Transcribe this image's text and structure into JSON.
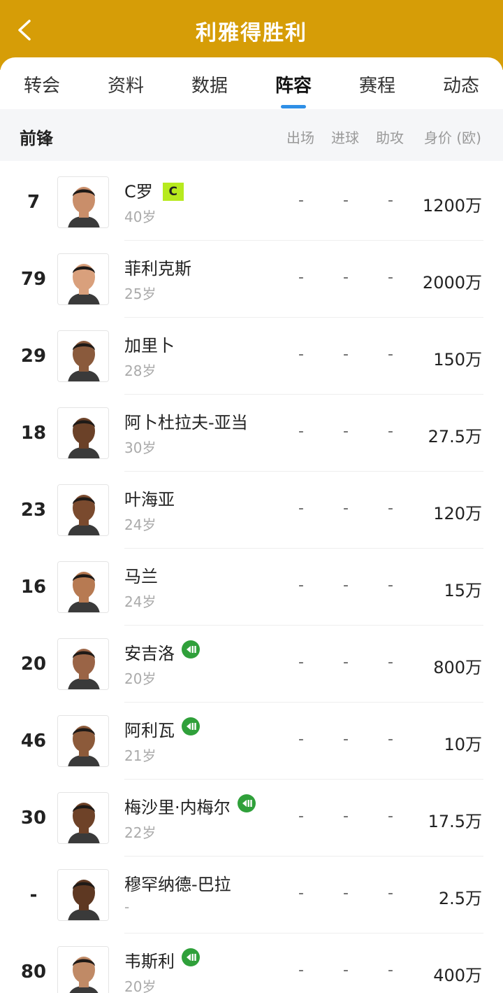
{
  "header": {
    "title": "利雅得胜利"
  },
  "tabs": [
    "转会",
    "资料",
    "数据",
    "阵容",
    "赛程",
    "动态"
  ],
  "active_tab": "阵容",
  "section": {
    "title": "前锋",
    "columns": [
      "出场",
      "进球",
      "助攻",
      "身价 (欧)"
    ]
  },
  "colors": {
    "header": "#D69D07",
    "tab_indicator": "#2F8FE6",
    "captain_badge": "#B7EA1E",
    "u_badge": "#2FA03A"
  },
  "players": [
    {
      "number": "7",
      "name": "C罗",
      "age": "40岁",
      "apps": "-",
      "goals": "-",
      "assists": "-",
      "value": "1200万",
      "captain": "C",
      "u_badge": false
    },
    {
      "number": "79",
      "name": "菲利克斯",
      "age": "25岁",
      "apps": "-",
      "goals": "-",
      "assists": "-",
      "value": "2000万",
      "u_badge": false
    },
    {
      "number": "29",
      "name": "加里卜",
      "age": "28岁",
      "apps": "-",
      "goals": "-",
      "assists": "-",
      "value": "150万",
      "u_badge": false
    },
    {
      "number": "18",
      "name": "阿卜杜拉夫-亚当",
      "age": "30岁",
      "apps": "-",
      "goals": "-",
      "assists": "-",
      "value": "27.5万",
      "u_badge": false
    },
    {
      "number": "23",
      "name": "叶海亚",
      "age": "24岁",
      "apps": "-",
      "goals": "-",
      "assists": "-",
      "value": "120万",
      "u_badge": false
    },
    {
      "number": "16",
      "name": "马兰",
      "age": "24岁",
      "apps": "-",
      "goals": "-",
      "assists": "-",
      "value": "15万",
      "u_badge": false
    },
    {
      "number": "20",
      "name": "安吉洛",
      "age": "20岁",
      "apps": "-",
      "goals": "-",
      "assists": "-",
      "value": "800万",
      "u_badge": true
    },
    {
      "number": "46",
      "name": "阿利瓦",
      "age": "21岁",
      "apps": "-",
      "goals": "-",
      "assists": "-",
      "value": "10万",
      "u_badge": true
    },
    {
      "number": "30",
      "name": "梅沙里·内梅尔",
      "age": "22岁",
      "apps": "-",
      "goals": "-",
      "assists": "-",
      "value": "17.5万",
      "u_badge": true
    },
    {
      "number": "-",
      "name": "穆罕纳德-巴拉",
      "age": "-",
      "apps": "-",
      "goals": "-",
      "assists": "-",
      "value": "2.5万",
      "u_badge": false
    },
    {
      "number": "80",
      "name": "韦斯利",
      "age": "20岁",
      "apps": "-",
      "goals": "-",
      "assists": "-",
      "value": "400万",
      "u_badge": true
    }
  ]
}
